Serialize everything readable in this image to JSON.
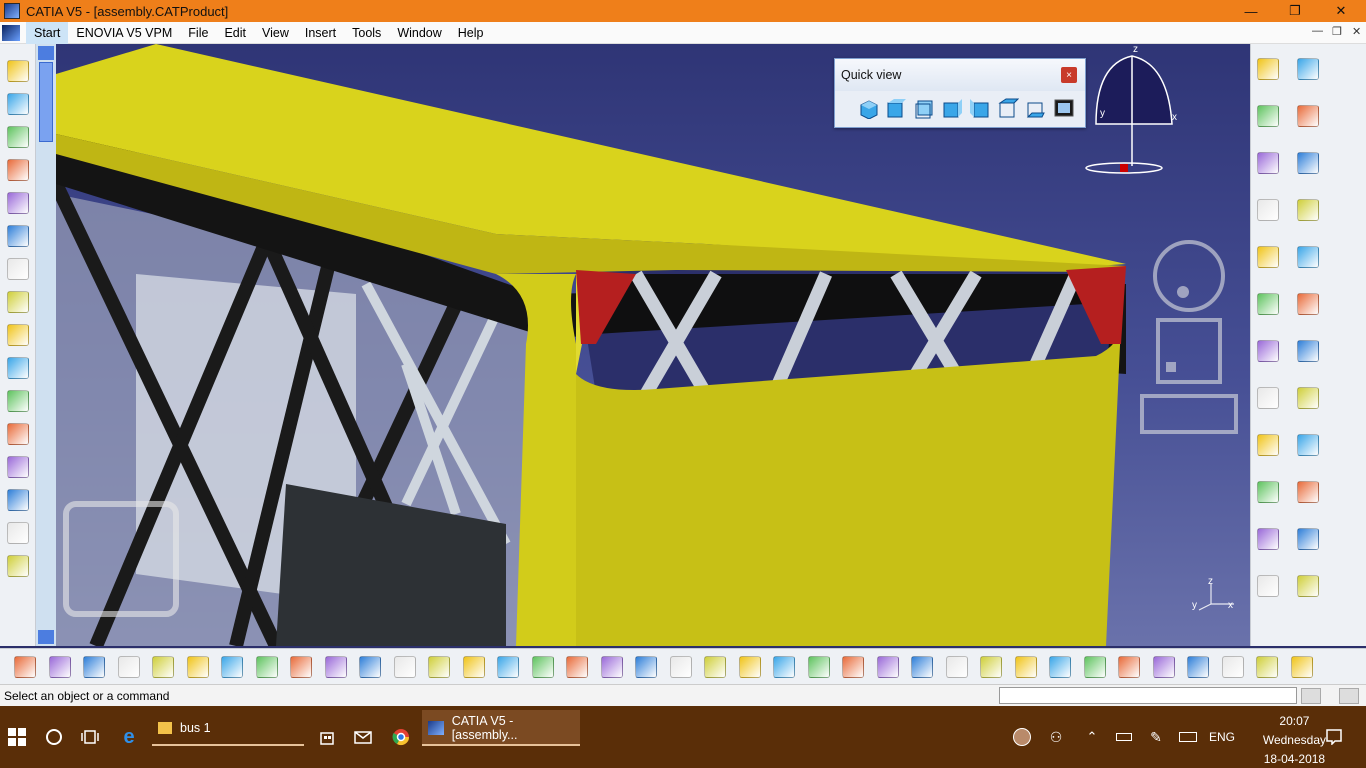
{
  "window": {
    "title": "CATIA V5 - [assembly.CATProduct]",
    "minimize_glyph": "—",
    "restore_glyph": "❐",
    "close_glyph": "✕"
  },
  "menu": {
    "items": [
      "Start",
      "ENOVIA V5 VPM",
      "File",
      "Edit",
      "View",
      "Insert",
      "Tools",
      "Window",
      "Help"
    ],
    "active": "Start",
    "mdi_controls": [
      "—",
      "❐",
      "✕"
    ]
  },
  "quick_view": {
    "title": "Quick view",
    "close_glyph": "×",
    "icons": [
      "isometric-view-icon",
      "front-view-icon",
      "back-view-icon",
      "left-view-icon",
      "right-view-icon",
      "top-view-icon",
      "bottom-view-icon",
      "named-views-icon"
    ]
  },
  "compass": {
    "x_label": "x",
    "y_label": "y",
    "z_label": "z"
  },
  "axis_triad": {
    "x_label": "x",
    "y_label": "y",
    "z_label": "z"
  },
  "toolbars": {
    "left": [
      "sketcher-icon",
      "sweep-surface-icon",
      "extrude-surface-icon",
      "offset-surface-icon",
      "fill-surface-icon",
      "blend-surface-icon",
      "pattern-icon",
      "project-curve-icon",
      "spline-icon",
      "connect-curve-icon",
      "parallel-curve-icon",
      "join-icon",
      "healing-icon",
      "split-icon",
      "trim-icon",
      "boundary-icon"
    ],
    "right": [
      "fly-mode-icon",
      "fit-all-icon",
      "pan-icon",
      "rotate-icon",
      "zoom-in-icon",
      "zoom-out-icon",
      "normal-view-icon",
      "multi-view-icon",
      "iso-view-icon",
      "shading-icon",
      "hide-show-icon",
      "swap-space-icon",
      "point-icon",
      "line-icon",
      "axis-icon",
      "plane-icon",
      "circle-icon",
      "projection-icon",
      "intersection-icon",
      "select-icon",
      "snap-icon",
      "catalog-icon",
      "extrapolate-icon",
      "translate-icon"
    ],
    "bottom": [
      "update-icon",
      "measure-between-icon",
      "measure-item-icon",
      "measure-inertia-icon",
      "capture-icon",
      "compass-icon",
      "apply-material-icon",
      "text-icon",
      "product-icon",
      "new-icon",
      "open-icon",
      "save-icon",
      "print-icon",
      "cut-icon",
      "copy-icon",
      "paste-icon",
      "undo-icon",
      "redo-icon",
      "whats-this-icon",
      "formula-icon",
      "knowledge-icon",
      "parameters-icon",
      "table-icon",
      "design-table-icon",
      "law-icon",
      "fit-all-in-icon",
      "pan-bottom-icon",
      "rotate-bottom-icon",
      "zoom-bottom-icon",
      "normal-bottom-icon",
      "grid-icon",
      "section-icon",
      "snap-bottom-icon",
      "clash-icon",
      "sectioning-icon",
      "assembly-constraints-icon",
      "analysis-icon",
      "catia-logo-icon"
    ]
  },
  "status": {
    "message": "Select an object or a command",
    "command_input": ""
  },
  "taskbar": {
    "folder_app": "bus 1",
    "catia_app": "CATIA V5 - [assembly...",
    "language": "ENG",
    "time": "20:07",
    "day": "Wednesday",
    "date": "18-04-2018"
  }
}
